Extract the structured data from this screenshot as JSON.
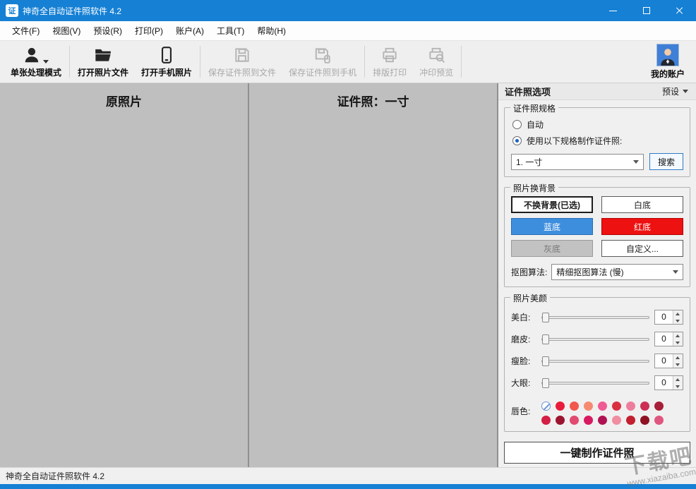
{
  "window": {
    "title": "神奇全自动证件照软件 4.2",
    "icon_text": "证"
  },
  "colors": {
    "titlebar_blue": "#1680d4",
    "panel_gray": "#bfbfbf"
  },
  "menu": {
    "items": [
      {
        "label": "文件(F)"
      },
      {
        "label": "视图(V)"
      },
      {
        "label": "预设(R)"
      },
      {
        "label": "打印(P)"
      },
      {
        "label": "账户(A)"
      },
      {
        "label": "工具(T)"
      },
      {
        "label": "帮助(H)"
      }
    ]
  },
  "toolbar": {
    "items": [
      {
        "label": "单张处理模式",
        "icon": "person-icon",
        "enabled": true
      },
      {
        "label": "打开照片文件",
        "icon": "open-folder-icon",
        "enabled": true
      },
      {
        "label": "打开手机照片",
        "icon": "smartphone-icon",
        "enabled": true
      },
      {
        "label": "保存证件照到文件",
        "icon": "save-file-icon",
        "enabled": false
      },
      {
        "label": "保存证件照到手机",
        "icon": "save-phone-icon",
        "enabled": false
      },
      {
        "label": "排版打印",
        "icon": "printer-icon",
        "enabled": false
      },
      {
        "label": "冲印预览",
        "icon": "print-preview-icon",
        "enabled": false
      }
    ],
    "account_label": "我的账户"
  },
  "panels": {
    "original_title": "原照片",
    "idphoto_title": "证件照：一寸"
  },
  "options": {
    "header": "证件照选项",
    "preset_label": "预设",
    "spec": {
      "group_title": "证件照规格",
      "radio_auto": "自动",
      "radio_use_spec": "使用以下规格制作证件照:",
      "spec_value": "1. 一寸",
      "search_label": "搜索"
    },
    "background": {
      "group_title": "照片换背景",
      "no_change_label": "不换背景(已选)",
      "white_label": "白底",
      "blue_label": "蓝底",
      "red_label": "红底",
      "gray_label": "灰底",
      "custom_label": "自定义...",
      "blue_color": "#3e8ede",
      "red_color": "#ee1111",
      "gray_color": "#c2c2c2",
      "matting_label": "抠图算法:",
      "matting_value": "精细抠图算法 (慢)"
    },
    "beauty": {
      "group_title": "照片美颜",
      "sliders": [
        {
          "label": "美白:",
          "value": "0"
        },
        {
          "label": "磨皮:",
          "value": "0"
        },
        {
          "label": "瘦脸:",
          "value": "0"
        },
        {
          "label": "大眼:",
          "value": "0"
        }
      ],
      "lip_label": "唇色:",
      "lip_colors": [
        "#e81b3a",
        "#f2574f",
        "#f58a70",
        "#ef5a93",
        "#d93040",
        "#ee7d9d",
        "#cc2f55",
        "#a81f38",
        "#d41e44",
        "#9c1530",
        "#e24a70",
        "#d81b60",
        "#b01353",
        "#f08da0",
        "#c2202f",
        "#8f1124",
        "#e0567f"
      ]
    },
    "make_button_label": "一键制作证件照"
  },
  "statusbar": {
    "text": "神奇全自动证件照软件 4.2"
  },
  "watermark": {
    "title": "下载吧",
    "url": "www.xiazaiba.com"
  }
}
